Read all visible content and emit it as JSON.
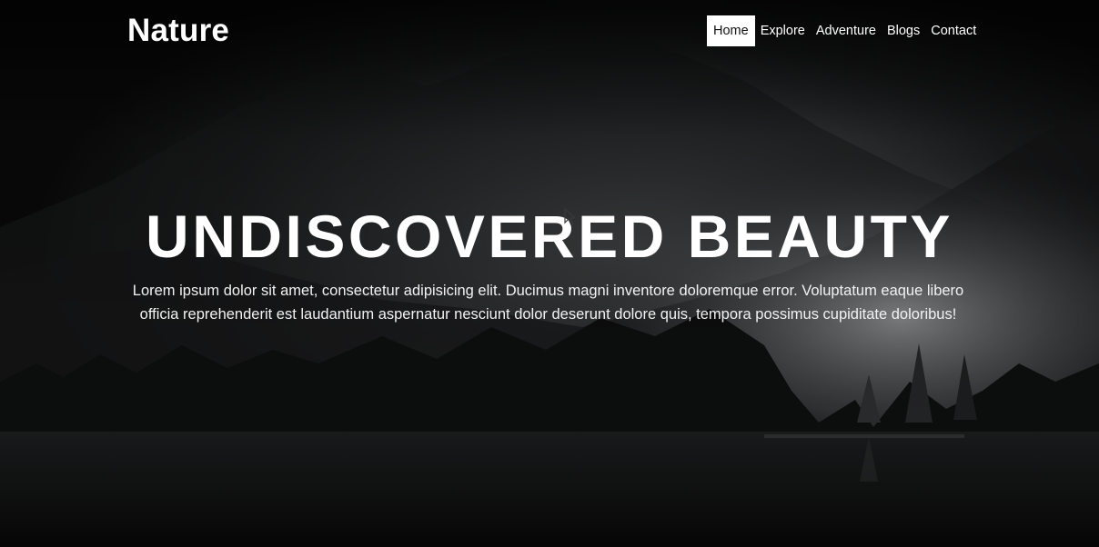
{
  "site": {
    "logo": "Nature"
  },
  "nav": {
    "items": [
      {
        "label": "Home",
        "active": true
      },
      {
        "label": "Explore",
        "active": false
      },
      {
        "label": "Adventure",
        "active": false
      },
      {
        "label": "Blogs",
        "active": false
      },
      {
        "label": "Contact",
        "active": false
      }
    ]
  },
  "hero": {
    "headline": "UNDISCOVERED BEAUTY",
    "text": "Lorem ipsum dolor sit amet, consectetur adipisicing elit. Ducimus magni inventore doloremque error. Voluptatum eaque libero officia reprehenderit est laudantium aspernatur nesciunt dolor deserunt dolore quis, tempora possimus cupiditate doloribus!",
    "background_image": "misty-forest-lake-photo"
  },
  "colors": {
    "accent": "#ffffff",
    "active_nav_text": "#111111",
    "overlay": "#000000"
  }
}
